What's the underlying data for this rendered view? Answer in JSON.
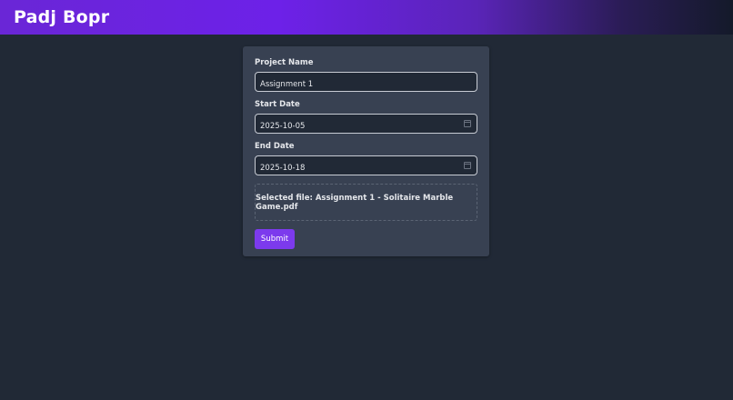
{
  "app": {
    "title": "Padj Bopr"
  },
  "form": {
    "project_name": {
      "label": "Project Name",
      "value": "Assignment 1"
    },
    "start_date": {
      "label": "Start Date",
      "value": "2025-10-05",
      "icon": "calendar-icon"
    },
    "end_date": {
      "label": "End Date",
      "value": "2025-10-18",
      "icon": "calendar-icon"
    },
    "file": {
      "text": "Selected file: Assignment 1 - Solitaire Marble Game.pdf"
    },
    "submit_label": "Submit"
  },
  "colors": {
    "background": "#212936",
    "card": "#384152",
    "accent": "#7c3aed"
  }
}
